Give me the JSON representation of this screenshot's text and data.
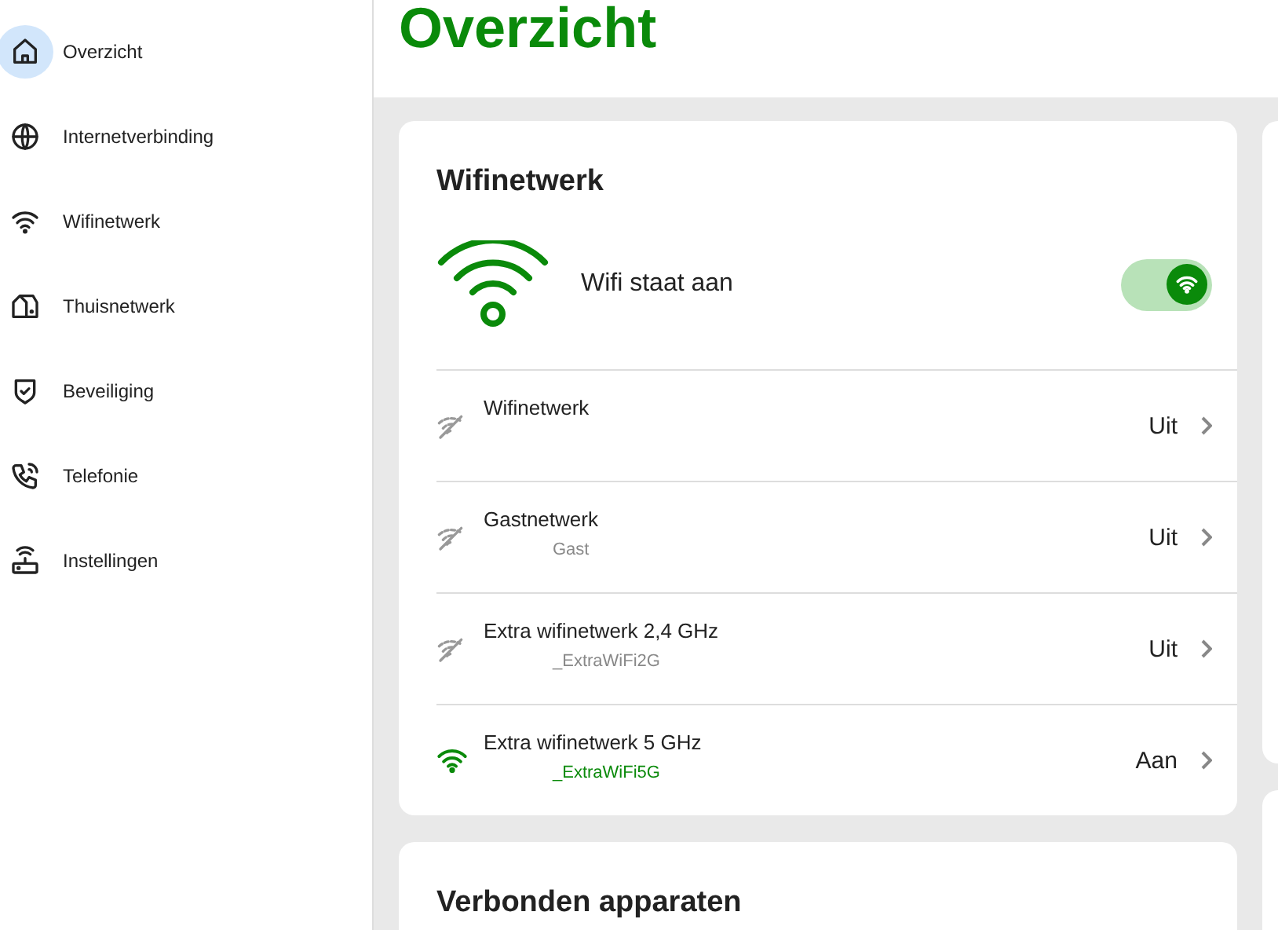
{
  "sidebar": {
    "items": [
      {
        "label": "Overzicht",
        "kind": "home",
        "selected": true
      },
      {
        "label": "Internetverbinding",
        "kind": "globe",
        "selected": false
      },
      {
        "label": "Wifinetwerk",
        "kind": "wifi",
        "selected": false
      },
      {
        "label": "Thuisnetwerk",
        "kind": "house",
        "selected": false
      },
      {
        "label": "Beveiliging",
        "kind": "shield",
        "selected": false
      },
      {
        "label": "Telefonie",
        "kind": "phone",
        "selected": false
      },
      {
        "label": "Instellingen",
        "kind": "router",
        "selected": false
      }
    ]
  },
  "page_title": "Overzicht",
  "wifi_card": {
    "title": "Wifinetwerk",
    "status": "Wifi staat aan",
    "toggle_on": true,
    "networks": [
      {
        "name": "Wifinetwerk",
        "on": false,
        "state": "Uit"
      },
      {
        "name": "Gastnetwerk",
        "ssid": "Gast",
        "on": false,
        "state": "Uit"
      },
      {
        "name": "Extra wifinetwerk 2,4 GHz",
        "ssid": "_ExtraWiFi2G",
        "on": false,
        "state": "Uit"
      },
      {
        "name": "Extra wifinetwerk 5 GHz",
        "ssid": "_ExtraWiFi5G",
        "on": true,
        "state": "Aan"
      }
    ]
  },
  "devices_card": {
    "title": "Verbonden apparaten"
  }
}
